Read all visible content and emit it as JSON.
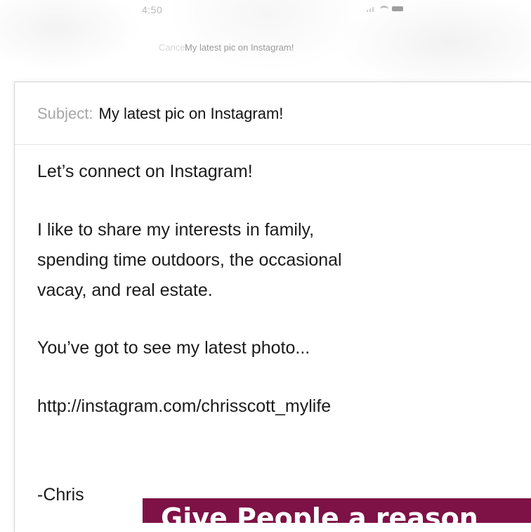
{
  "status_bar": {
    "time": "4:50",
    "icons": [
      "signal-icon",
      "wifi-icon",
      "battery-icon"
    ]
  },
  "nav": {
    "cancel_label": "Cancel",
    "title": "My latest pic on Instagram!"
  },
  "email": {
    "subject_label": "Subject:",
    "subject_value": "My latest pic on Instagram!",
    "body": {
      "line1": "Let’s connect on Instagram!",
      "line2": "I like to share my interests in family,",
      "line3": "spending time outdoors, the occasional",
      "line4": "vacay, and real estate.",
      "line5": "You’ve got to see my latest photo...",
      "line6": "http://instagram.com/chrisscott_mylife",
      "line7": "-Chris"
    }
  },
  "banner": {
    "text": "Give People a reason",
    "color": "#7e1146"
  }
}
